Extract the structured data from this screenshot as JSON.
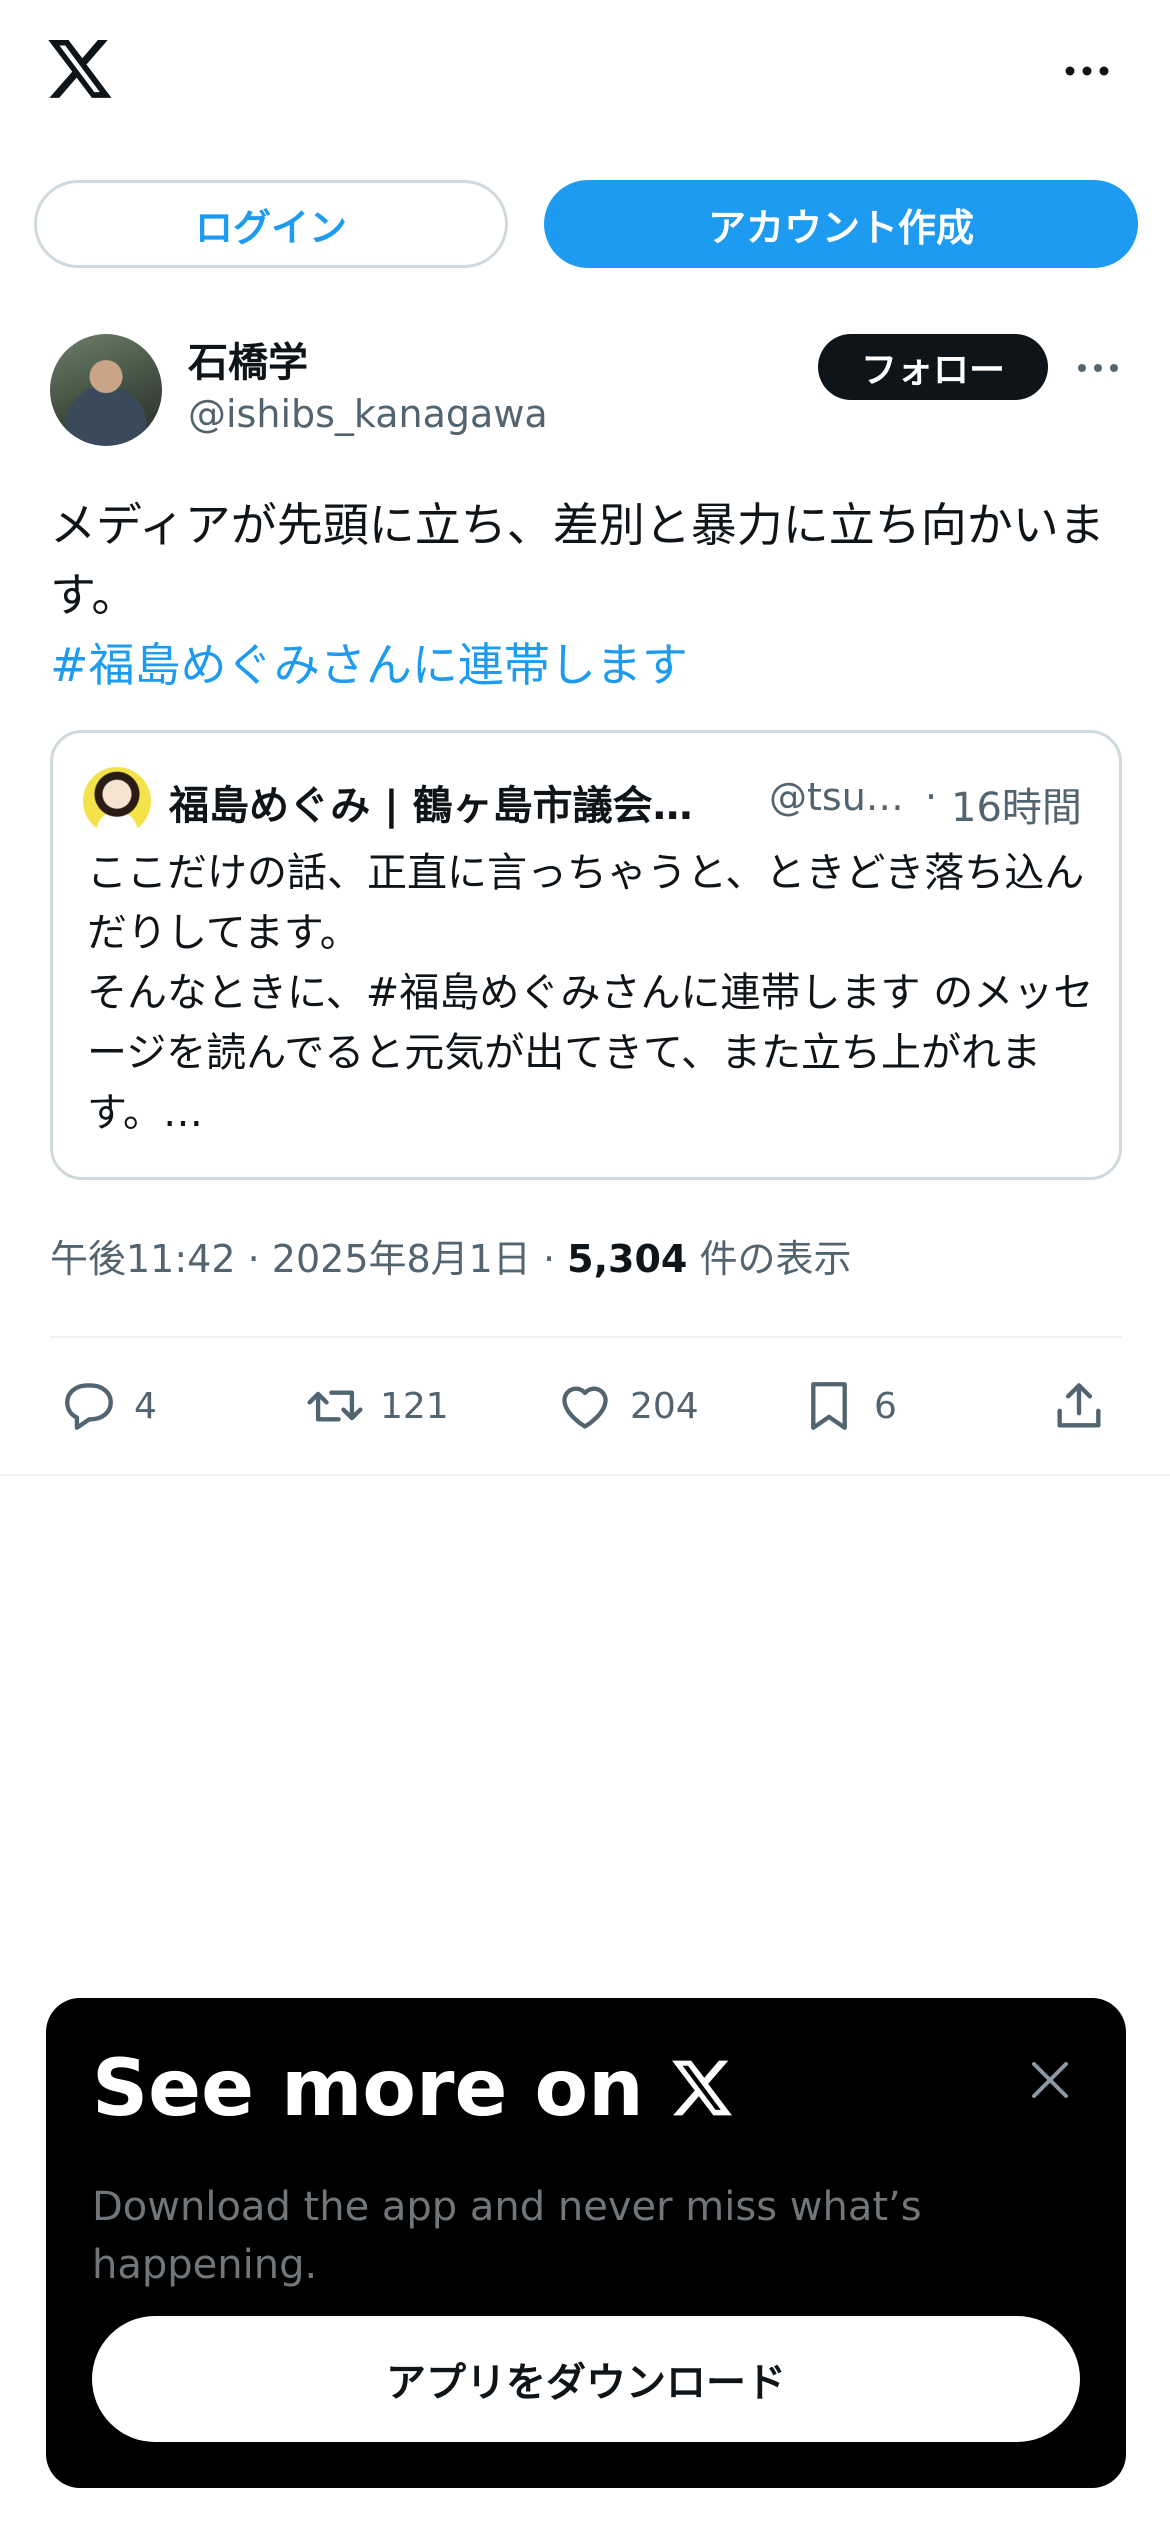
{
  "header": {
    "logo_icon": "x-logo-icon",
    "more_icon": "more-horizontal-icon"
  },
  "auth": {
    "login_label": "ログイン",
    "signup_label": "アカウント作成"
  },
  "post": {
    "author_name": "石橋学",
    "author_handle": "@ishibs_kanagawa",
    "follow_label": "フォロー",
    "text": "メディアが先頭に立ち、差別と暴力に立ち向かいます。",
    "hashtag": "#福島めぐみさんに連帯します",
    "time": "午後11:42",
    "date": "2025年8月1日",
    "views_count": "5,304",
    "views_label": "件の表示",
    "separator": "·"
  },
  "quote": {
    "name": "福島めぐみ | 鶴ヶ島市議会議員",
    "handle": "@tsurugashima",
    "dot": "·",
    "time": "16時間",
    "text": "ここだけの話、正直に言っちゃうと、ときどき落ち込んだりしてます。\nそんなときに、#福島めぐみさんに連帯します のメッセージを読んでると元気が出てきて、また立ち上がれます。…"
  },
  "actions": {
    "replies": "4",
    "reposts": "121",
    "likes": "204",
    "bookmarks": "6",
    "icons": [
      "reply-icon",
      "repost-icon",
      "like-icon",
      "bookmark-icon",
      "share-icon"
    ]
  },
  "banner": {
    "title": "See more on",
    "subtitle": "Download the app and never miss what’s happening.",
    "download_label": "アプリをダウンロード"
  },
  "colors": {
    "accent": "#1d9bf0",
    "text": "#0f1419",
    "muted": "#536471",
    "border": "#cfd9de",
    "banner_bg": "#000000"
  }
}
